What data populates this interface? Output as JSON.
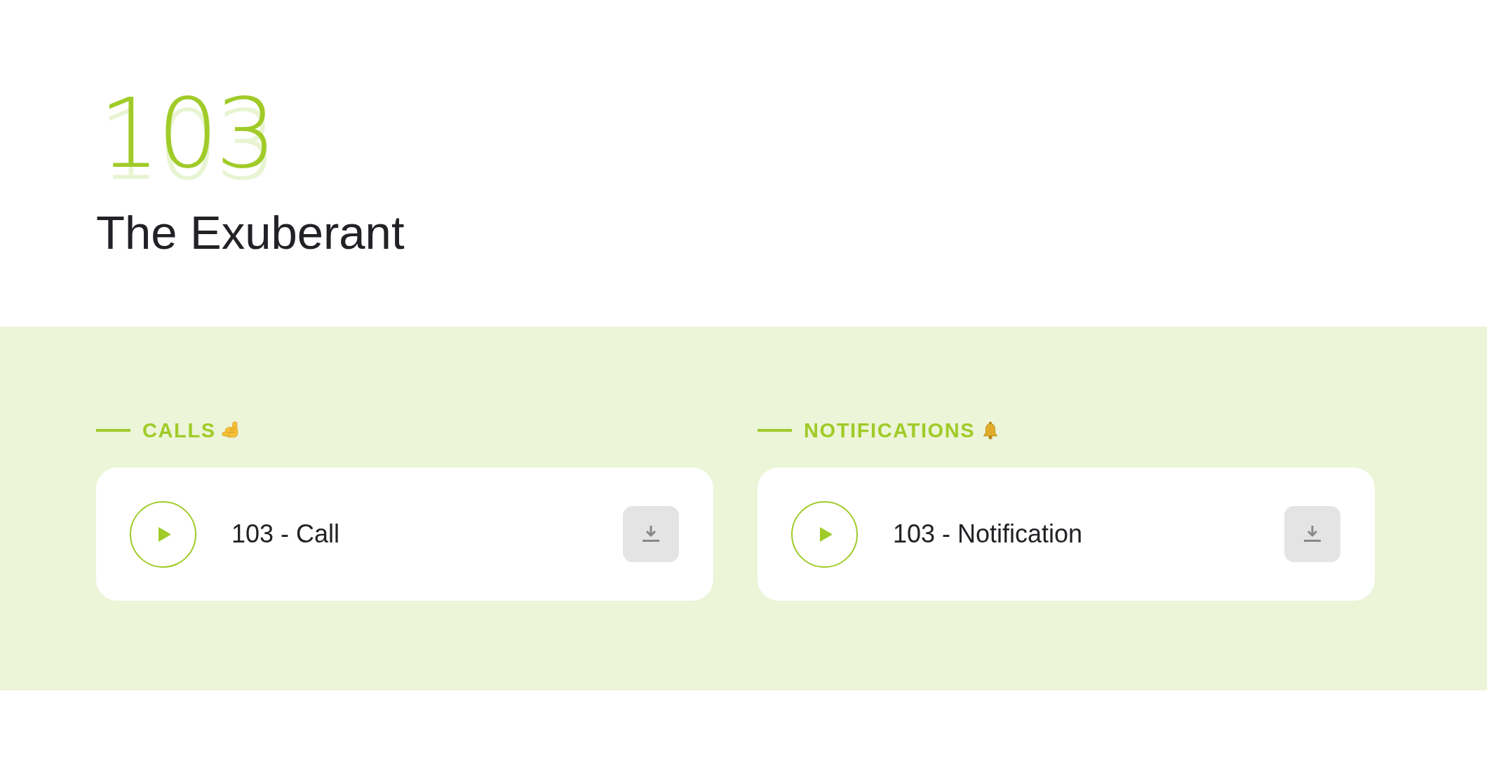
{
  "header": {
    "number": "103",
    "title": "The Exuberant"
  },
  "sections": [
    {
      "kind": "calls",
      "heading": "CALLS",
      "items": [
        {
          "label": "103 - Call"
        }
      ]
    },
    {
      "kind": "notifications",
      "heading": "NOTIFICATIONS",
      "items": [
        {
          "label": "103 - Notification"
        }
      ]
    }
  ]
}
